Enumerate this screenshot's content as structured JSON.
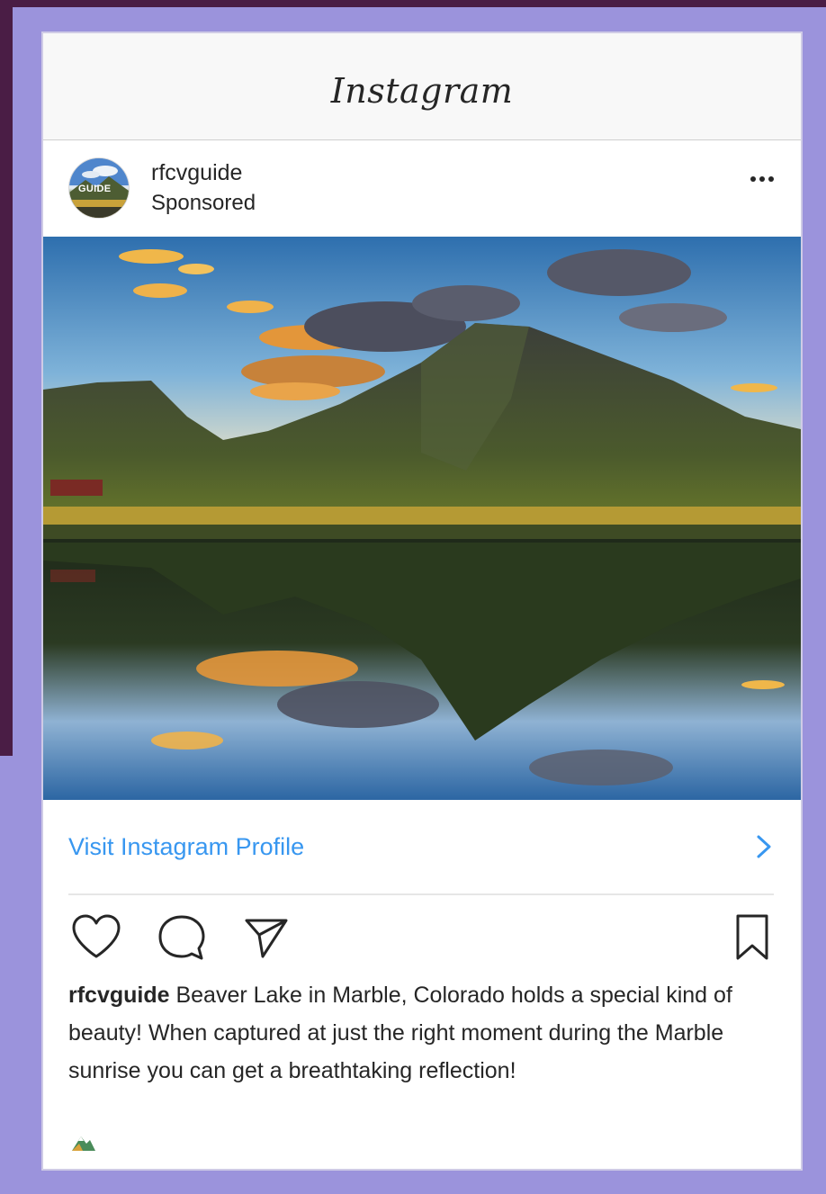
{
  "app": {
    "title": "Instagram"
  },
  "post": {
    "username": "rfcvguide",
    "sponsored_label": "Sponsored",
    "avatar_text": "GUIDE",
    "cta_label": "Visit Instagram Profile",
    "caption_user": "rfcvguide",
    "caption_text": " Beaver Lake in Marble, Colorado holds a special kind of beauty! When captured at just the right moment during the Marble sunrise you can get a breathtaking reflection!"
  },
  "icons": {
    "more": "more-horizontal-icon",
    "like": "heart-icon",
    "comment": "comment-bubble-icon",
    "share": "paper-plane-icon",
    "save": "bookmark-icon",
    "cta": "chevron-right-icon",
    "emoji": "mountain-emoji-icon"
  },
  "colors": {
    "background": "#9b93dc",
    "accent_dark": "#4a1d45",
    "link": "#3897f0",
    "text": "#262626"
  }
}
